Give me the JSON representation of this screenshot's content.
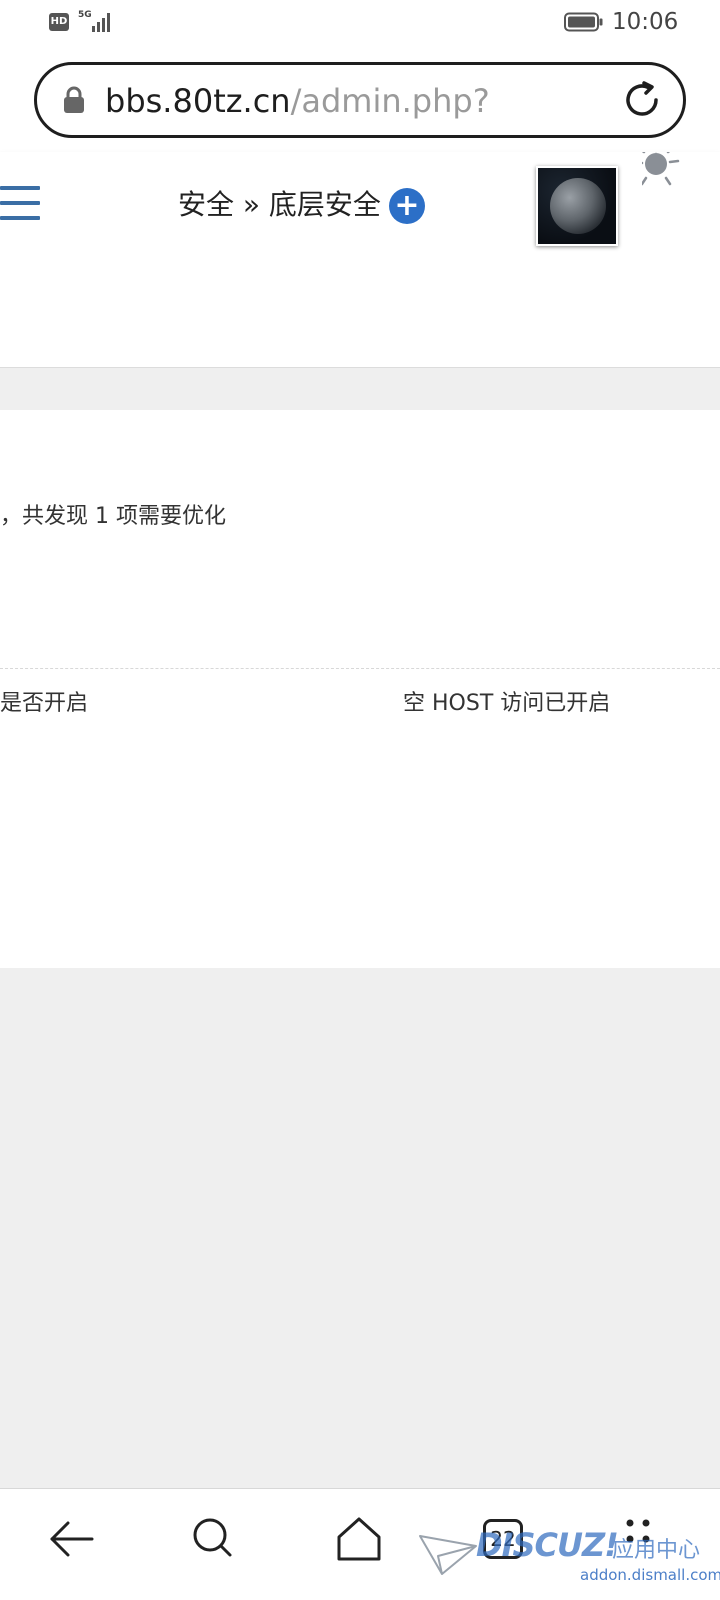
{
  "status_bar": {
    "hd_badge": "HD",
    "network_type": "5G",
    "time": "10:06"
  },
  "browser": {
    "url_host": "bbs.80tz.cn",
    "url_path": "/admin.php?"
  },
  "admin_header": {
    "breadcrumb": "安全 » 底层安全",
    "add_icon": "+"
  },
  "security_check": {
    "summary": "，共发现 1 项需要优化",
    "rows": [
      {
        "name": "是否开启",
        "result": "空 HOST 访问已开启"
      }
    ]
  },
  "bottom_nav": {
    "tab_count": "22",
    "icons": [
      "back-icon",
      "search-icon",
      "home-icon",
      "tabs-icon",
      "more-icon"
    ]
  },
  "watermark": {
    "brand": "DISCUZ!",
    "suffix": "应用中心",
    "sub": "addon.dismall.com"
  },
  "colors": {
    "accent": "#2c6fc7",
    "menu": "#3a6ea5",
    "background": "#efefef"
  }
}
